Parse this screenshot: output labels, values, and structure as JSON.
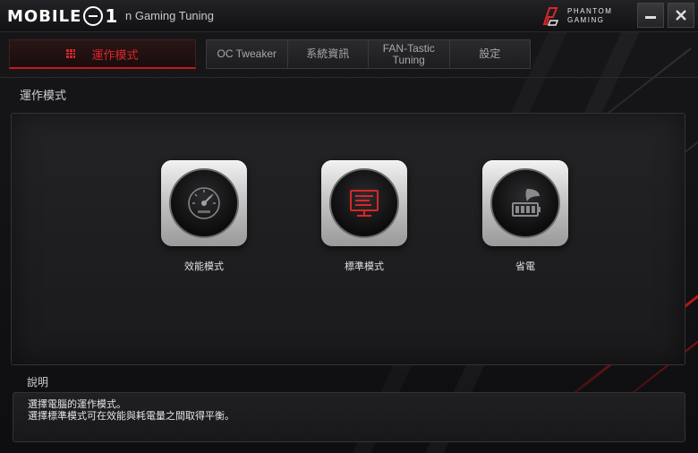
{
  "titlebar": {
    "watermark": "MOBILE",
    "watermark_suffix": "1",
    "app_title": "n Gaming Tuning",
    "brand_line1": "PHANTOM",
    "brand_line2": "GAMING",
    "minimize_icon": "minimize-icon",
    "close_icon": "close-icon"
  },
  "tabs": {
    "active": "運作模式",
    "items": [
      {
        "label": "OC Tweaker"
      },
      {
        "label": "系統資訊"
      },
      {
        "label": "FAN-Tastic\nTuning"
      },
      {
        "label": "設定"
      }
    ]
  },
  "main": {
    "section_title": "運作模式",
    "modes": [
      {
        "label": "效能模式",
        "icon": "speedometer-icon"
      },
      {
        "label": "標準模式",
        "icon": "monitor-icon",
        "accent": "#d8262a"
      },
      {
        "label": "省電",
        "icon": "battery-leaf-icon"
      }
    ]
  },
  "description": {
    "title": "說明",
    "line1": "選擇電腦的運作模式。",
    "line2": "選擇標準模式可在效能與耗電量之間取得平衡。"
  },
  "colors": {
    "accent": "#d8262a",
    "background": "#0d0d0f"
  }
}
